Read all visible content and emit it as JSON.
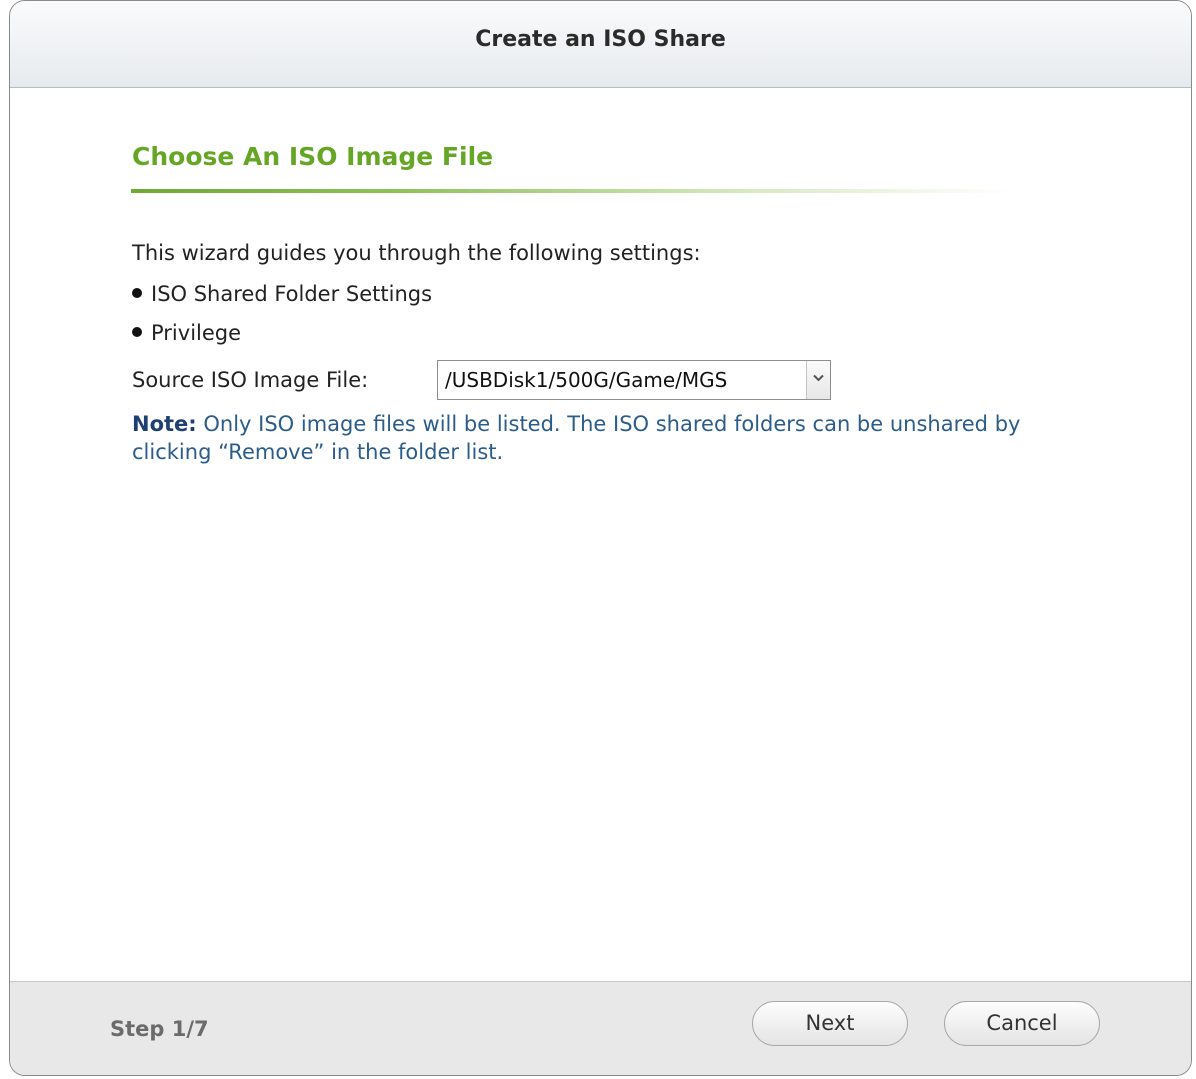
{
  "dialog": {
    "title": "Create an ISO Share"
  },
  "section": {
    "title": "Choose An ISO Image File"
  },
  "intro": "This wizard guides you through the following settings:",
  "bullets": [
    {
      "label": "ISO Shared Folder Settings"
    },
    {
      "label": "Privilege"
    }
  ],
  "source": {
    "label": "Source ISO Image File:",
    "selected_value": "/USBDisk1/500G/Game/MGS"
  },
  "note": {
    "label": "Note:",
    "text": " Only ISO image files will be listed. The ISO shared folders can be unshared by clicking “Remove” in the folder list."
  },
  "footer": {
    "step": "Step 1/7",
    "next_label": "Next",
    "cancel_label": "Cancel"
  },
  "colors": {
    "section_title": "#66a625",
    "note_text": "#2b5c8a",
    "note_label": "#1d3f74"
  },
  "icons": {
    "dropdown": "chevron-down-icon",
    "bullet": "bullet-dot-icon"
  }
}
